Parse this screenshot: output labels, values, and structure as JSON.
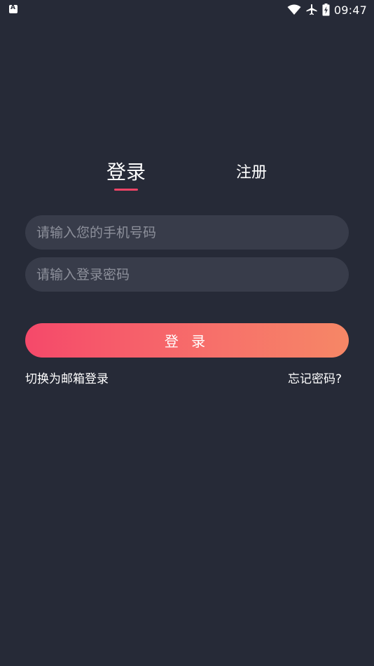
{
  "status_bar": {
    "time": "09:47",
    "icons": [
      "accessibility-a-icon",
      "wifi-icon",
      "airplane-icon",
      "battery-charging-icon"
    ]
  },
  "tabs": {
    "login_label": "登录",
    "register_label": "注册"
  },
  "form": {
    "phone_placeholder": "请输入您的手机号码",
    "phone_value": "",
    "password_placeholder": "请输入登录密码",
    "password_value": ""
  },
  "login_button_label": "登 录",
  "links": {
    "switch_email": "切换为邮箱登录",
    "forgot_password": "忘记密码?"
  },
  "colors": {
    "background": "#262a37",
    "input_background": "#383c4a",
    "accent": "#ee4466",
    "button_gradient_start": "#f5496a",
    "button_gradient_end": "#f68766"
  }
}
